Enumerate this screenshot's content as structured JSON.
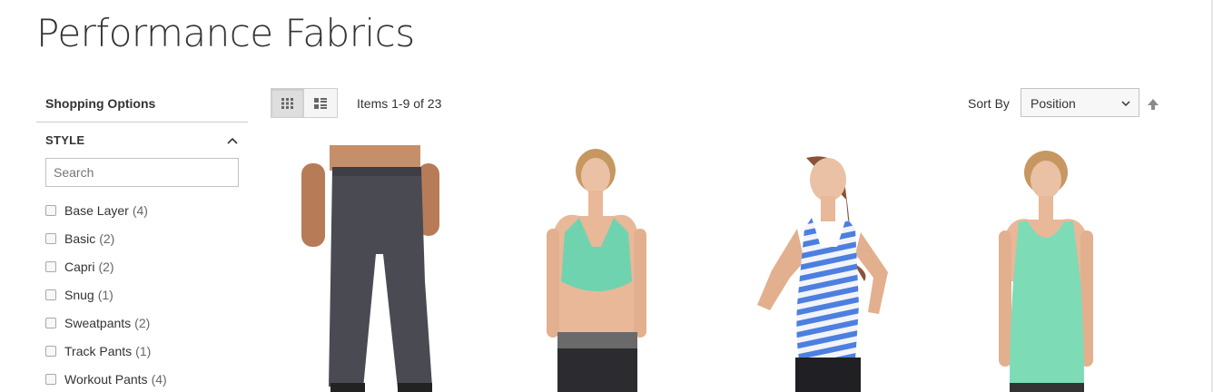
{
  "page": {
    "title": "Performance Fabrics"
  },
  "sidebar": {
    "title": "Shopping Options",
    "filter": {
      "label": "STYLE",
      "search_placeholder": "Search",
      "options": [
        {
          "label": "Base Layer",
          "count": "(4)"
        },
        {
          "label": "Basic",
          "count": "(2)"
        },
        {
          "label": "Capri",
          "count": "(2)"
        },
        {
          "label": "Snug",
          "count": "(1)"
        },
        {
          "label": "Sweatpants",
          "count": "(2)"
        },
        {
          "label": "Track Pants",
          "count": "(1)"
        },
        {
          "label": "Workout Pants",
          "count": "(4)"
        }
      ]
    }
  },
  "toolbar": {
    "view_modes": [
      "grid-icon",
      "list-icon"
    ],
    "amount": "Items 1-9 of 23",
    "sort_label": "Sort By",
    "sort_value": "Position",
    "sort_direction_icon": "arrow-up-icon"
  },
  "products": [
    {
      "image": "men-sweatpants-photo",
      "color": "#4a4a52"
    },
    {
      "image": "women-bra-photo",
      "color": "#6fd3b0"
    },
    {
      "image": "women-striped-tank-photo",
      "color": "#4d7fe0"
    },
    {
      "image": "women-tank-photo",
      "color": "#7ddbb6"
    }
  ],
  "colors": {
    "border": "#cccccc",
    "text": "#333333",
    "skin": "#e8b898"
  }
}
